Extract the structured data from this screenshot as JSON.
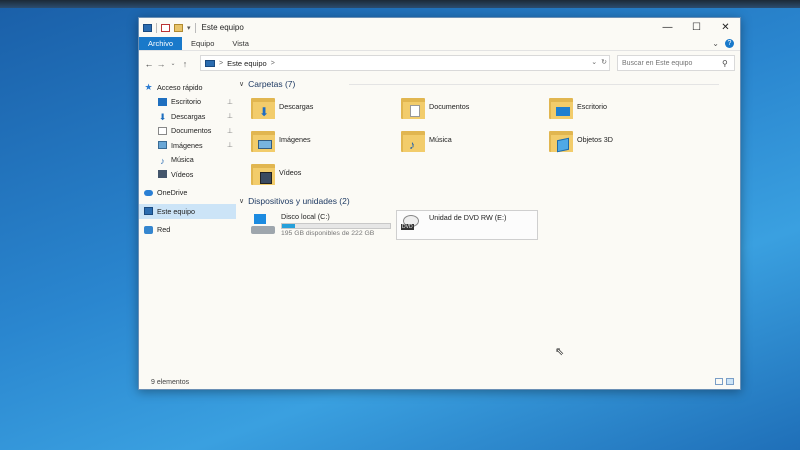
{
  "window": {
    "title": "Este equipo",
    "controls": {
      "minimize": "—",
      "maximize": "☐",
      "close": "✕"
    }
  },
  "ribbon": {
    "tabs": [
      {
        "label": "Archivo"
      },
      {
        "label": "Equipo"
      },
      {
        "label": "Vista"
      }
    ],
    "expand_glyph": "⌄",
    "help_glyph": "?"
  },
  "address_bar": {
    "back": "←",
    "forward": "→",
    "recent": "⌄",
    "up": "↑",
    "location": "Este equipo",
    "separator_glyph": ">",
    "dropdown_glyph": "⌄",
    "refresh_glyph": "↻"
  },
  "search": {
    "placeholder": "Buscar en Este equipo"
  },
  "sidebar": {
    "quick_access": "Acceso rápido",
    "items": [
      {
        "label": "Escritorio",
        "pinned": true
      },
      {
        "label": "Descargas",
        "pinned": true
      },
      {
        "label": "Documentos",
        "pinned": true
      },
      {
        "label": "Imágenes",
        "pinned": true
      },
      {
        "label": "Música",
        "pinned": false
      },
      {
        "label": "Vídeos",
        "pinned": false
      }
    ],
    "onedrive": "OneDrive",
    "this_pc": "Este equipo",
    "network": "Red",
    "pin_glyph": "📌"
  },
  "content": {
    "folders_header": "Carpetas (7)",
    "folders": [
      {
        "label": "Descargas",
        "icon": "download-arrow"
      },
      {
        "label": "Documentos",
        "icon": "document"
      },
      {
        "label": "Escritorio",
        "icon": "desktop"
      },
      {
        "label": "Imágenes",
        "icon": "pictures"
      },
      {
        "label": "Música",
        "icon": "music-note"
      },
      {
        "label": "Objetos 3D",
        "icon": "cube-3d"
      },
      {
        "label": "Vídeos",
        "icon": "film"
      }
    ],
    "devices_header": "Dispositivos y unidades (2)",
    "drives": [
      {
        "label": "Disco local (C:)",
        "free": "195 GB disponibles de 222 GB",
        "used_fraction": 0.12
      },
      {
        "label": "Unidad de DVD RW (E:)",
        "badge": "DVD"
      }
    ]
  },
  "status": {
    "items": "9 elementos"
  },
  "colors": {
    "accent": "#1979ca",
    "selection": "#cce4f7",
    "progress": "#26a0da"
  }
}
